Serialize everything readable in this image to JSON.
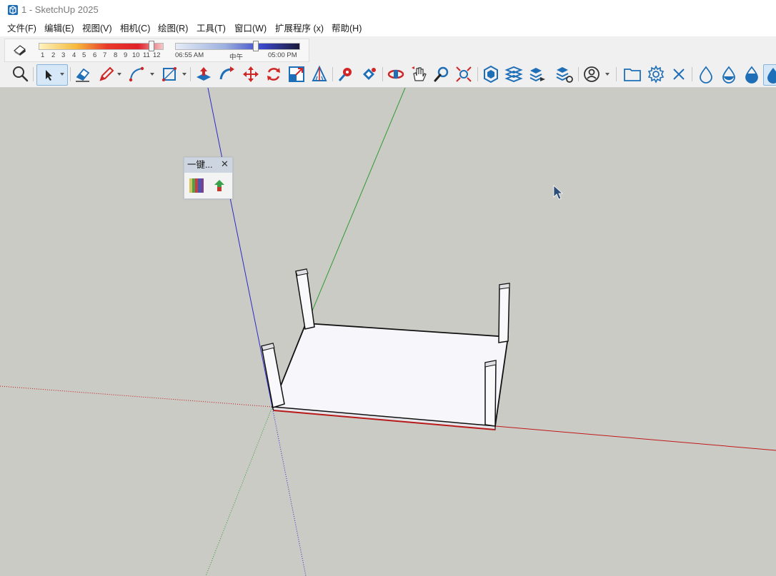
{
  "window": {
    "title": "1 - SketchUp 2025"
  },
  "menu": {
    "items": [
      "文件(F)",
      "编辑(E)",
      "视图(V)",
      "相机(C)",
      "绘图(R)",
      "工具(T)",
      "窗口(W)",
      "扩展程序 (x)",
      "帮助(H)"
    ]
  },
  "shadow": {
    "month_ticks": [
      "1",
      "2",
      "3",
      "4",
      "5",
      "6",
      "7",
      "8",
      "9",
      "10",
      "11",
      "12"
    ],
    "month_value": 11,
    "time_start": "06:55 AM",
    "time_mid": "中午",
    "time_end": "05:00 PM",
    "time_value_fraction": 0.65
  },
  "floating_panel": {
    "title": "一键...",
    "close_symbol": "✕"
  },
  "colors": {
    "accent": "#1e6fb8",
    "viewport_bg": "#cbcbc6",
    "red_axis": "#c01818",
    "green_axis": "#2f9a2f",
    "blue_axis": "#2a2ac8"
  },
  "toolbar_icons": [
    "search-icon",
    "select-icon",
    "eraser-icon",
    "pencil-icon",
    "arc-icon",
    "rectangle-icon",
    "push-pull-icon",
    "follow-me-icon",
    "move-icon",
    "rotate-icon",
    "scale-icon",
    "protractor-icon",
    "tape-measure-icon",
    "paint-bucket-icon",
    "orbit-icon",
    "pan-icon",
    "zoom-icon",
    "zoom-extents-icon",
    "components-icon",
    "layers-icon",
    "outliner-icon",
    "styles-icon",
    "profile-icon",
    "folder-icon",
    "settings-icon",
    "close-icon",
    "drop-outline-icon",
    "drop-half-icon",
    "drop-fill-icon",
    "drop-active-icon"
  ]
}
